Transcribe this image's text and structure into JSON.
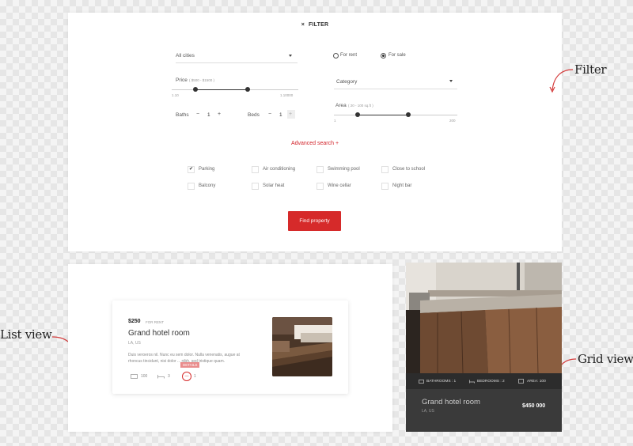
{
  "filter": {
    "title": "FILTER",
    "close_icon": "×",
    "city": "All cities",
    "radio_rent": "For rent",
    "radio_sale": "For sale",
    "selected_mode": "sale",
    "category": "Category",
    "price_label": "Price",
    "price_range": "( $500 - $1500 )",
    "price_min": "1.10",
    "price_max": "1.10000",
    "area_label": "Area",
    "area_range": "( 20 - 100 sq.ft )",
    "area_min": "1",
    "area_max": "200",
    "baths_label": "Baths",
    "baths_value": "1",
    "beds_label": "Beds",
    "beds_value": "1",
    "minus": "−",
    "plus": "+",
    "advanced": "Advanced search +",
    "amenities": [
      {
        "label": "Parking",
        "checked": true,
        "check": "✔"
      },
      {
        "label": "Air conditioning",
        "checked": false,
        "check": ""
      },
      {
        "label": "Swimming pool",
        "checked": false,
        "check": ""
      },
      {
        "label": "Close to school",
        "checked": false,
        "check": ""
      },
      {
        "label": "Balcony",
        "checked": false,
        "check": ""
      },
      {
        "label": "Solar heat",
        "checked": false,
        "check": ""
      },
      {
        "label": "Wine cellar",
        "checked": false,
        "check": ""
      },
      {
        "label": "Night bar",
        "checked": false,
        "check": ""
      }
    ],
    "find_button": "Find property",
    "accent": "#d62a2a"
  },
  "annotations": {
    "filter": "Filter",
    "list_view": "List view",
    "grid_view": "Grid view"
  },
  "list_card": {
    "price": "$250",
    "for": "FOR RENT",
    "title": "Grand hotel room",
    "location": "LA, US",
    "description": "Duis veroeros nil. Nunc eu sem dolor. Nulla venenatis, augue at rhoncus tincidunt, nisi dolor ... nibh, sed tristique quam.",
    "tag": "DETAILS",
    "area": "100",
    "beds": "3",
    "baths": "1"
  },
  "grid_card": {
    "bathrooms": "BATHROOMS : 1",
    "bedrooms": "BEDROOMS : 2",
    "area": "AREA: 100",
    "title": "Grand hotel room",
    "location": "LA, US",
    "price": "$450 000"
  }
}
